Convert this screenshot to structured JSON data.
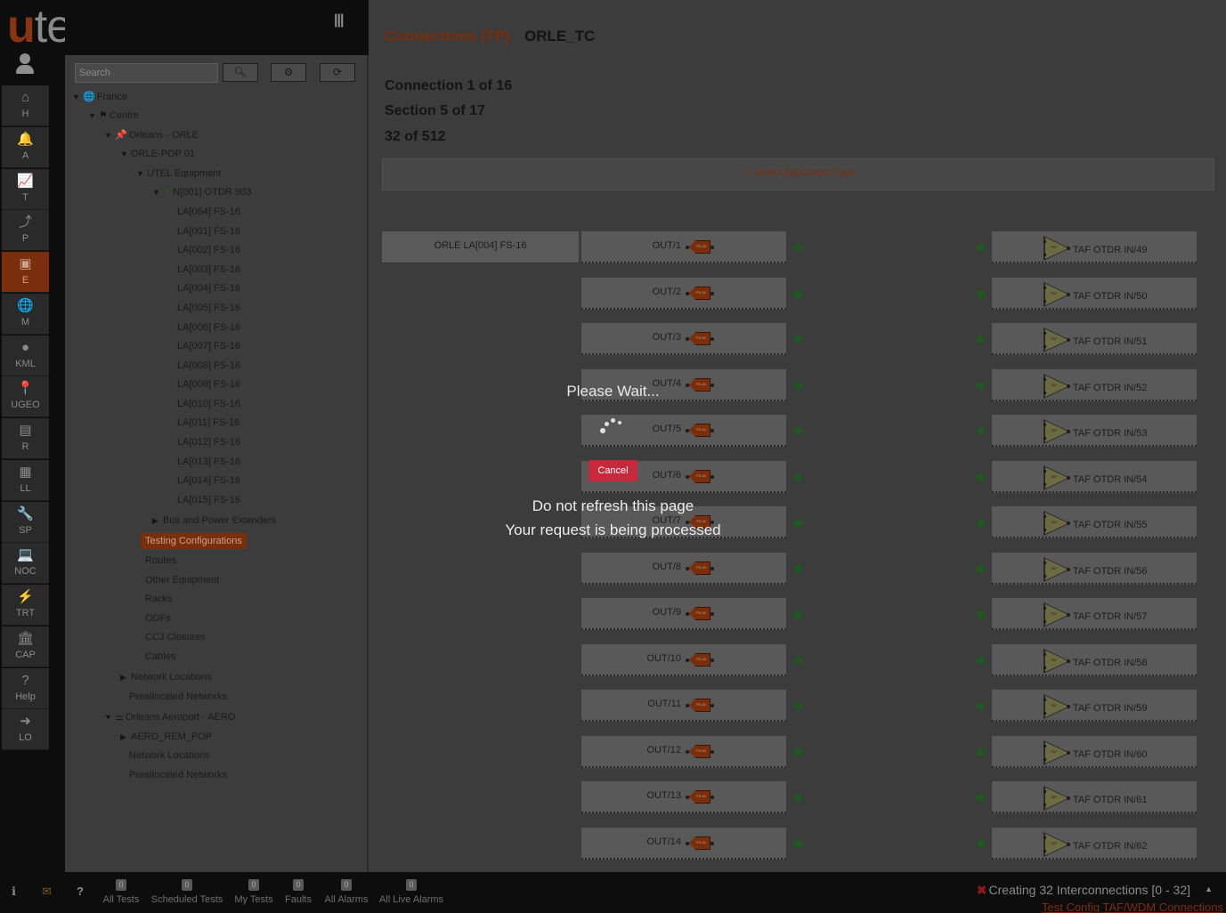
{
  "brand": {
    "logo_first": "u",
    "logo_rest": "tel"
  },
  "header": {
    "title_connections": "Connections (TP)",
    "site_name": "ORLE_TC"
  },
  "nav": [
    {
      "icon": "⌂",
      "label": "H"
    },
    {
      "icon": "🔔",
      "label": "A"
    },
    {
      "icon": "📈",
      "label": "T"
    },
    {
      "icon": "⤴",
      "label": "P"
    },
    {
      "icon": "▣",
      "label": "E"
    },
    {
      "icon": "🌐",
      "label": "M"
    },
    {
      "icon": "●",
      "label": "KML"
    },
    {
      "icon": "📍",
      "label": "UGEO"
    },
    {
      "icon": "▤",
      "label": "R"
    },
    {
      "icon": "▦",
      "label": "LL"
    },
    {
      "icon": "🔧",
      "label": "SP"
    },
    {
      "icon": "💻",
      "label": "NOC"
    },
    {
      "icon": "⚡",
      "label": "TRT"
    },
    {
      "icon": "🏛",
      "label": "CAP"
    },
    {
      "icon": "?",
      "label": "Help"
    },
    {
      "icon": "➜",
      "label": "LO"
    }
  ],
  "search": {
    "placeholder": "Search"
  },
  "tree": [
    {
      "label": "France",
      "icon": "🌐"
    },
    {
      "label": "Centre",
      "icon": "⚑"
    },
    {
      "label": "Orleans - ORLE",
      "icon": "📌"
    },
    {
      "label": "ORLE-POP 01",
      "icon": ""
    },
    {
      "label": "UTEL Equipment",
      "icon": ""
    },
    {
      "label": "N[001] OTDR 903",
      "icon": "✔"
    },
    {
      "label": "LA[064] FS-16"
    },
    {
      "label": "LA[001] FS-16"
    },
    {
      "label": "LA[002] FS-16"
    },
    {
      "label": "LA[003] FS-16"
    },
    {
      "label": "LA[004] FS-16"
    },
    {
      "label": "LA[005] FS-16"
    },
    {
      "label": "LA[006] FS-16"
    },
    {
      "label": "LA[007] FS-16"
    },
    {
      "label": "LA[008] FS-16"
    },
    {
      "label": "LA[009] FS-16"
    },
    {
      "label": "LA[010] FS-16"
    },
    {
      "label": "LA[011] FS-16"
    },
    {
      "label": "LA[012] FS-16"
    },
    {
      "label": "LA[013] FS-16"
    },
    {
      "label": "LA[014] FS-16"
    },
    {
      "label": "LA[015] FS-16"
    },
    {
      "label": "Bus and Power Extenders"
    },
    {
      "label": "Testing Configurations"
    },
    {
      "label": "Routes"
    },
    {
      "label": "Other Equipment"
    },
    {
      "label": "Racks"
    },
    {
      "label": "ODFs"
    },
    {
      "label": "CCJ Closures"
    },
    {
      "label": "Cables"
    },
    {
      "label": "Network Locations"
    },
    {
      "label": "Preallocated Networks"
    },
    {
      "label": "Orleans Aeroport - AERO",
      "icon": "⚌"
    },
    {
      "label": "AERO_REM_POP"
    },
    {
      "label": "Network Locations"
    },
    {
      "label": "Preallocated Networks"
    }
  ],
  "info": {
    "connection": "Connection 1 of 16",
    "section": "Section 5 of 17",
    "count": "32 of 512"
  },
  "select_equipment": "Select Equipment Type",
  "source_equipment": "ORLE LA[004] FS-16",
  "port_tag": "FS-16",
  "taf_tag": "TAF",
  "ports": [
    {
      "out": "OUT/1",
      "taf": "TAF OTDR IN/49"
    },
    {
      "out": "OUT/2",
      "taf": "TAF OTDR IN/50"
    },
    {
      "out": "OUT/3",
      "taf": "TAF OTDR IN/51"
    },
    {
      "out": "OUT/4",
      "taf": "TAF OTDR IN/52"
    },
    {
      "out": "OUT/5",
      "taf": "TAF OTDR IN/53"
    },
    {
      "out": "OUT/6",
      "taf": "TAF OTDR IN/54"
    },
    {
      "out": "OUT/7",
      "taf": "TAF OTDR IN/55"
    },
    {
      "out": "OUT/8",
      "taf": "TAF OTDR IN/56"
    },
    {
      "out": "OUT/9",
      "taf": "TAF OTDR IN/57"
    },
    {
      "out": "OUT/10",
      "taf": "TAF OTDR IN/58"
    },
    {
      "out": "OUT/11",
      "taf": "TAF OTDR IN/59"
    },
    {
      "out": "OUT/12",
      "taf": "TAF OTDR IN/60"
    },
    {
      "out": "OUT/13",
      "taf": "TAF OTDR IN/61"
    },
    {
      "out": "OUT/14",
      "taf": "TAF OTDR IN/62"
    }
  ],
  "overlay": {
    "title": "Please Wait...",
    "cancel": "Cancel",
    "line1": "Do not refresh this page",
    "line2": "Your request is being processed"
  },
  "bottom": {
    "counters": [
      {
        "count": "0",
        "label": "All Tests"
      },
      {
        "count": "0",
        "label": "Scheduled Tests"
      },
      {
        "count": "0",
        "label": "My Tests"
      },
      {
        "count": "0",
        "label": "Faults"
      },
      {
        "count": "0",
        "label": "All Alarms"
      },
      {
        "count": "0",
        "label": "All Live Alarms"
      }
    ],
    "status": "Creating 32 Interconnections [0 - 32]",
    "status_link": "Test Config TAF/WDM Connections"
  },
  "colors": {
    "accent": "#7a2e0c",
    "cancel": "#c8283c",
    "status_ok": "#1e5a1e"
  }
}
